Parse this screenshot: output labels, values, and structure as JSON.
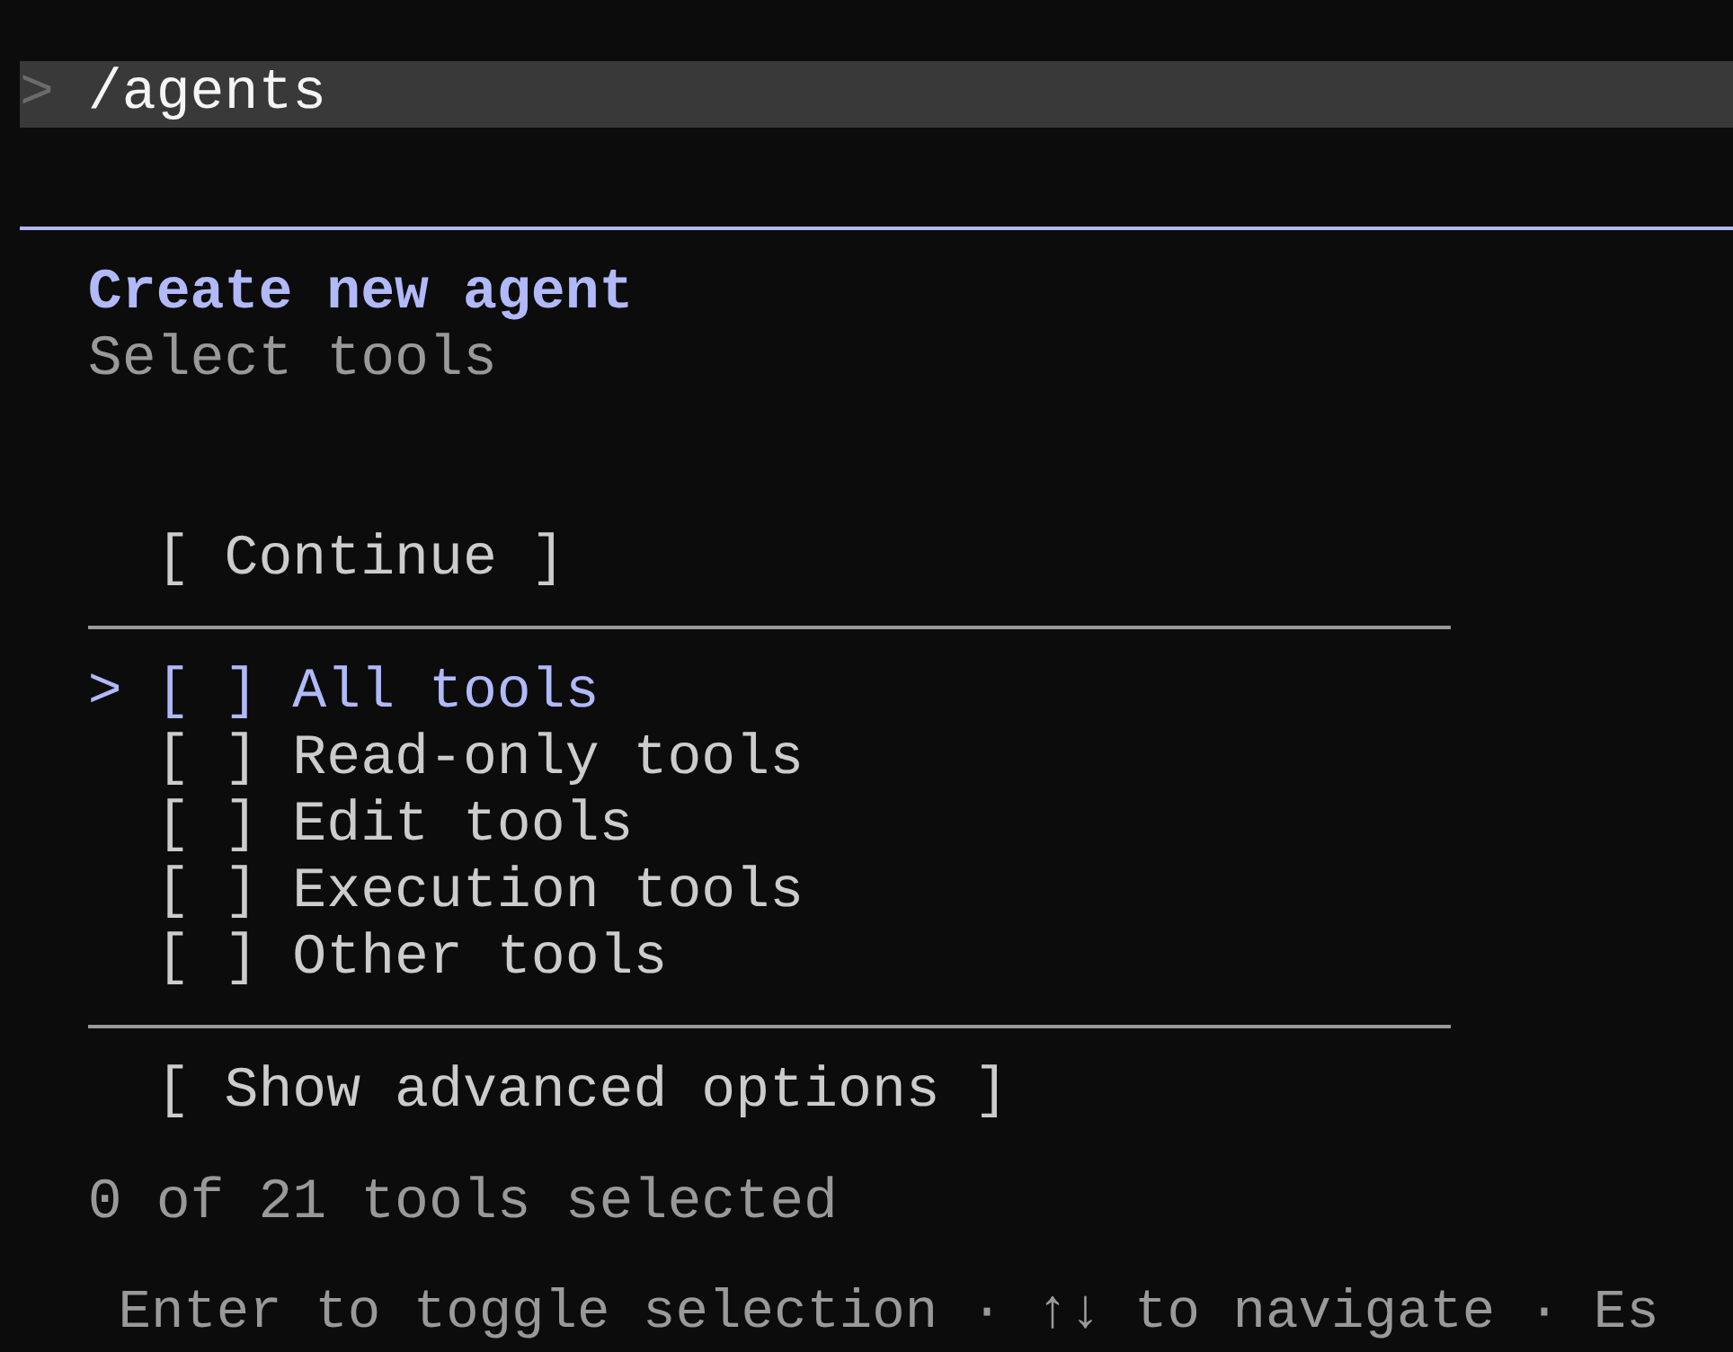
{
  "prompt": {
    "symbol": ">",
    "command": "/agents"
  },
  "dialog": {
    "title": "Create new agent",
    "subtitle": "Select tools",
    "continue_button": "[ Continue ]",
    "pointer": ">",
    "options": [
      {
        "box": "[ ]",
        "label": "All tools",
        "checked": false,
        "selected": true
      },
      {
        "box": "[ ]",
        "label": "Read-only tools",
        "checked": false,
        "selected": false
      },
      {
        "box": "[ ]",
        "label": "Edit tools",
        "checked": false,
        "selected": false
      },
      {
        "box": "[ ]",
        "label": "Execution tools",
        "checked": false,
        "selected": false
      },
      {
        "box": "[ ]",
        "label": "Other tools",
        "checked": false,
        "selected": false
      }
    ],
    "advanced_button": "[ Show advanced options ]",
    "selection_count": "0 of 21 tools selected"
  },
  "help_text": "Enter to toggle selection · ↑↓ to navigate · Es"
}
